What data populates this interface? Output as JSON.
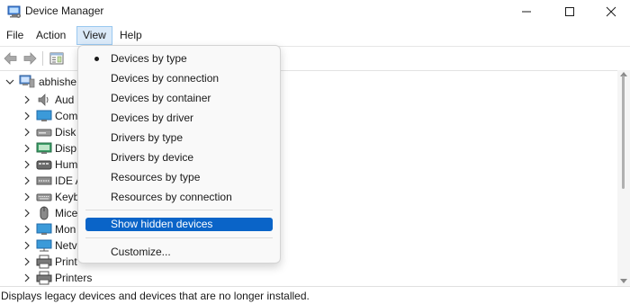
{
  "window": {
    "title": "Device Manager",
    "controls": [
      "minimize-icon",
      "maximize-icon",
      "close-icon"
    ]
  },
  "menubar": {
    "items": [
      "File",
      "Action",
      "View",
      "Help"
    ]
  },
  "toolbar": {
    "buttons": [
      "back-arrow-icon",
      "forward-arrow-icon",
      "properties-icon"
    ]
  },
  "tree": {
    "root": "abhishe",
    "items": [
      {
        "label": "Aud",
        "icon": "speaker-icon"
      },
      {
        "label": "Com",
        "icon": "monitor-icon"
      },
      {
        "label": "Disk",
        "icon": "disk-drive-icon"
      },
      {
        "label": "Disp",
        "icon": "display-adapter-icon"
      },
      {
        "label": "Hum",
        "icon": "hid-icon"
      },
      {
        "label": "IDE A",
        "icon": "ide-icon"
      },
      {
        "label": "Keyb",
        "icon": "keyboard-icon"
      },
      {
        "label": "Mice",
        "icon": "mouse-icon"
      },
      {
        "label": "Mon",
        "icon": "monitor-icon"
      },
      {
        "label": "Netv",
        "icon": "network-icon"
      },
      {
        "label": "Print",
        "icon": "printer-icon"
      },
      {
        "label": "Printers",
        "icon": "printer-icon"
      }
    ]
  },
  "view_menu": {
    "items": [
      {
        "label": "Devices by type",
        "checked": true
      },
      {
        "label": "Devices by connection",
        "checked": false
      },
      {
        "label": "Devices by container",
        "checked": false
      },
      {
        "label": "Devices by driver",
        "checked": false
      },
      {
        "label": "Drivers by type",
        "checked": false
      },
      {
        "label": "Drivers by device",
        "checked": false
      },
      {
        "label": "Resources by type",
        "checked": false
      },
      {
        "label": "Resources by connection",
        "checked": false
      }
    ],
    "show_hidden": "Show hidden devices",
    "customize": "Customize..."
  },
  "statusbar": {
    "text": "Displays legacy devices and devices that are no longer installed."
  },
  "colors": {
    "highlight": "#0a64c8",
    "menu_active": "#dbeaf9"
  }
}
